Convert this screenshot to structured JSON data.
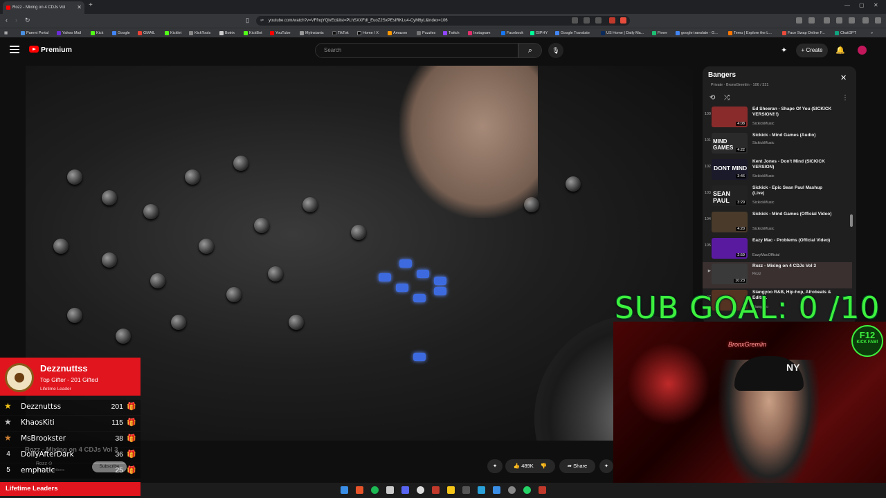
{
  "browser": {
    "tab_title": "Rozz - Mixing on 4 CDJs Vol",
    "url": "youtube.com/watch?v=VFfnqYQlvEc&list=PLhSXXFdI_EuoZ2SxPEsIRKLu4-CyM6yL&index=106",
    "bookmarks": [
      "Parent Portal",
      "Yahoo Mail",
      "Kick",
      "Google",
      "GMAIL",
      "Kicklet",
      "KickTools",
      "Botrix",
      "KickBot",
      "YouTube",
      "MyInstants",
      "TikTok",
      "Home / X",
      "Amazon",
      "Puzzles",
      "Twitch",
      "Instagram",
      "Facebook",
      "GIPHY",
      "Google Translate",
      "US Home | Daily Ma...",
      "Fiverr",
      "google translate - G...",
      "Temu | Explore the L...",
      "Face Swap Online F...",
      "ChatGPT"
    ]
  },
  "youtube": {
    "brand": "Premium",
    "search_placeholder": "Search",
    "create_label": "Create"
  },
  "playlist": {
    "title": "Bangers",
    "meta": "Private · BronxGremlin · 106 / 321",
    "items": [
      {
        "num": "100",
        "title": "Ed Sheeran - Shape Of You (SICKICK VERSION!!!)",
        "channel": "SickickMusic",
        "duration": "4:08",
        "thumb_color": "#8a2b2b"
      },
      {
        "num": "101",
        "title": "Sickick - Mind Games (Audio)",
        "channel": "SickickMusic",
        "duration": "4:22",
        "thumb_color": "#2a2a2a",
        "thumb_text": "MIND GAMES"
      },
      {
        "num": "102",
        "title": "Kent Jones - Don't Mind (SICKICK VERSION)",
        "channel": "SickickMusic",
        "duration": "3:46",
        "thumb_color": "#1a1a2a",
        "thumb_text": "DONT MIND"
      },
      {
        "num": "103",
        "title": "Sickick - Epic Sean Paul Mashup (Live)",
        "channel": "SickickMusic",
        "duration": "3:29",
        "thumb_color": "#222",
        "thumb_text": "SEAN PAUL"
      },
      {
        "num": "104",
        "title": "Sickick - Mind Games (Official Video)",
        "channel": "SickickMusic",
        "duration": "4:20",
        "thumb_color": "#4a3a2a"
      },
      {
        "num": "105",
        "title": "Eazy Mac - Problems (Official Video)",
        "channel": "EazyMacOfficial",
        "duration": "2:59",
        "thumb_color": "#5a1aa0"
      },
      {
        "num": "▶",
        "title": "Rozz - Mixing on 4 CDJs Vol 3",
        "channel": "Rozz",
        "duration": "10:23",
        "thumb_color": "#3a3a3a"
      },
      {
        "num": "107",
        "title": "Siangyoo R&B, Hip-hop, Afrobeats & Edits...",
        "channel": "Siangyoo",
        "duration": "",
        "thumb_color": "#553322"
      }
    ]
  },
  "overlay": {
    "sub_goal": "SUB GOAL: 0 /10",
    "badge_line1": "F12",
    "badge_line2": "KICK FAM!",
    "neon_sign": "BronxGremlin"
  },
  "leaderboard": {
    "top_name": "Dezznuttss",
    "top_subtitle": "Top Gifter - 201 Gifted",
    "top_badge": "Lifetime Leader",
    "rows": [
      {
        "rank": "★",
        "name": "Dezznuttss",
        "count": "201",
        "star_color": "#f5c518",
        "gift_color": "#3ecf3e"
      },
      {
        "rank": "★",
        "name": "KhaosKiti",
        "count": "115",
        "star_color": "#c0c0c0",
        "gift_color": "#f5c518"
      },
      {
        "rank": "★",
        "name": "MsBrookster",
        "count": "38",
        "star_color": "#cd7f32",
        "gift_color": "#9b59d0"
      },
      {
        "rank": "4",
        "name": "DollyAfterDark",
        "count": "36",
        "star_color": "",
        "gift_color": "#9b59d0"
      },
      {
        "rank": "5",
        "name": "emphatic",
        "count": "25",
        "star_color": "",
        "gift_color": "#9b59d0"
      }
    ],
    "footer": "Lifetime Leaders"
  },
  "video_meta": {
    "title": "Rozz - Mixing on 4 CDJs Vol 3",
    "channel": "Rozz ⊙",
    "subs": "0.9K subscribers",
    "subscribe_label": "Subscribe",
    "likes": "489K",
    "share_label": "Share"
  },
  "colors": {
    "accent_red": "#ff0000",
    "goal_green": "#3ef03e",
    "leader_red": "#e0151d"
  }
}
